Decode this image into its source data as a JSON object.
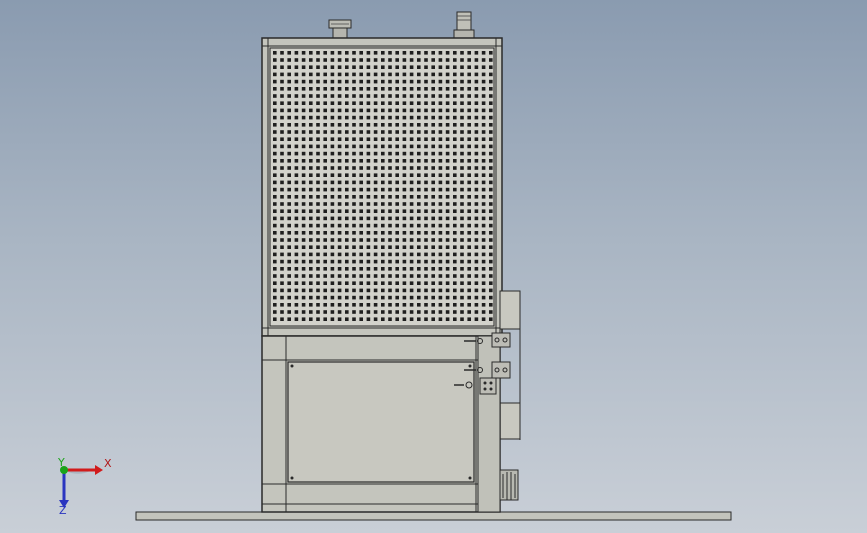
{
  "viewport": {
    "background_top": "#8a9bb0",
    "background_bottom": "#c9cfd7"
  },
  "model": {
    "description_icon": "machine-enclosure",
    "body_color": "#c4c5bd",
    "panel_color": "#c8c8c0",
    "mesh_color": "#d2d2cb",
    "edge_color": "#2a2a2a",
    "hole_color": "#1e1e1e"
  },
  "triad": {
    "x_label": "X",
    "y_label": "Y",
    "z_label": "Z",
    "x_color": "#d11b1b",
    "y_color": "#1aa31a",
    "z_color": "#2a35c0"
  }
}
